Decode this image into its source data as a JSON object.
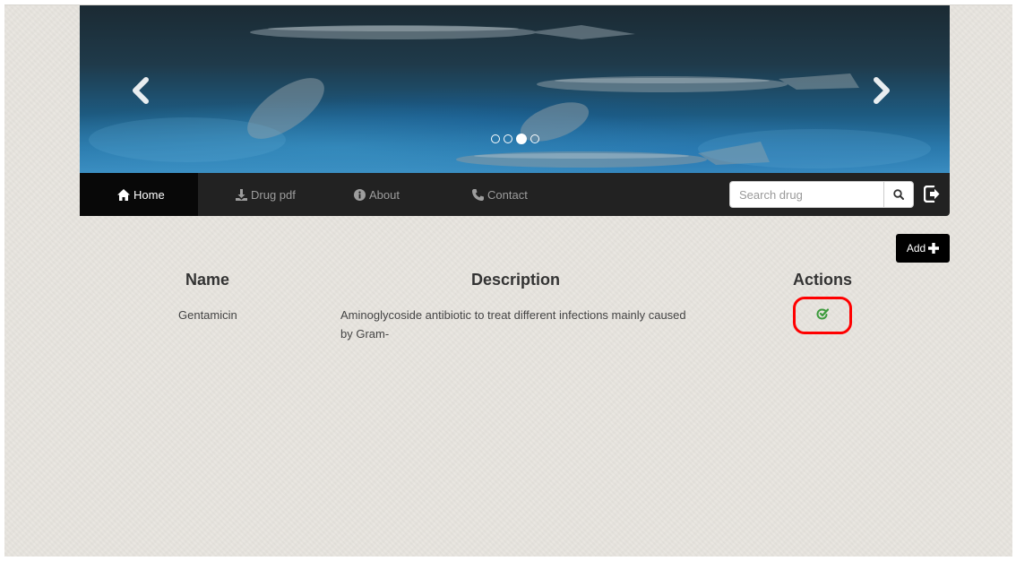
{
  "carousel": {
    "prev_icon": "chevron-left-icon",
    "next_icon": "chevron-right-icon",
    "indicators": [
      {
        "active": false
      },
      {
        "active": false
      },
      {
        "active": true
      },
      {
        "active": false
      }
    ]
  },
  "navbar": {
    "items": [
      {
        "label": "Home",
        "icon": "home-icon",
        "active": true
      },
      {
        "label": "Drug pdf",
        "icon": "download-icon",
        "active": false
      },
      {
        "label": "About",
        "icon": "info-icon",
        "active": false
      },
      {
        "label": "Contact",
        "icon": "phone-icon",
        "active": false
      }
    ],
    "search": {
      "placeholder": "Search drug",
      "value": "",
      "icon": "search-icon"
    },
    "logout_icon": "logout-icon"
  },
  "toolbar": {
    "add_label": "Add",
    "add_icon": "plus-icon"
  },
  "table": {
    "headers": {
      "name": "Name",
      "description": "Description",
      "actions": "Actions"
    },
    "rows": [
      {
        "name": "Gentamicin",
        "description_line1": "Aminoglycoside antibiotic to treat different infections mainly caused",
        "description_line2": "by Gram-",
        "action_icon": "edit-icon"
      }
    ]
  },
  "colors": {
    "navbar_bg": "#222222",
    "nav_active_bg": "#080808",
    "edit_icon": "#3c9b3c",
    "highlight": "#ff0000"
  }
}
